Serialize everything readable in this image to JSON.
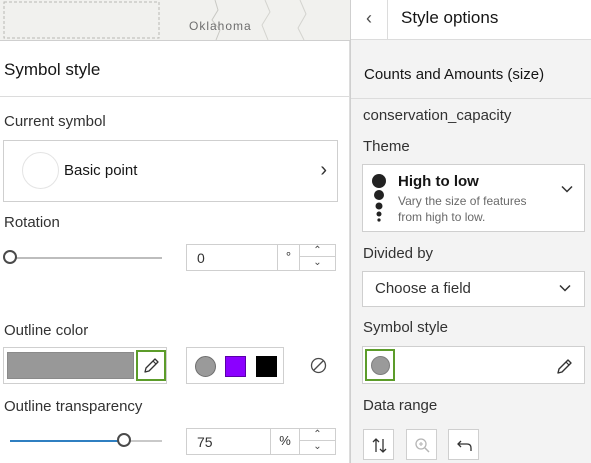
{
  "map": {
    "label": "Oklahoma"
  },
  "symbol_panel": {
    "title": "Symbol style",
    "current_symbol": {
      "label": "Current symbol",
      "value": "Basic point"
    },
    "rotation": {
      "label": "Rotation",
      "value": "0",
      "unit": "°",
      "slider_fraction": 0.0
    },
    "outline_color": {
      "label": "Outline color",
      "color": "#989898",
      "swatches": [
        "#9a9a9a",
        "#8b00ff",
        "#000000"
      ]
    },
    "outline_transparency": {
      "label": "Outline transparency",
      "value": "75",
      "unit": "%",
      "slider_fraction": 0.75
    }
  },
  "style_options": {
    "title": "Style options",
    "back_icon": "chevron-left-icon",
    "subtitle": "Counts and Amounts (size)",
    "field_name": "conservation_capacity",
    "theme": {
      "label": "Theme",
      "title": "High to low",
      "description": "Vary the size of features from high to low."
    },
    "divided_by": {
      "label": "Divided by",
      "value": "Choose a field"
    },
    "symbol_style": {
      "label": "Symbol style"
    },
    "data_range": {
      "label": "Data range",
      "icons": [
        "swap-icon",
        "zoom-icon",
        "undo-icon"
      ]
    }
  },
  "colors": {
    "accent_selected": "#5c9c2a"
  }
}
